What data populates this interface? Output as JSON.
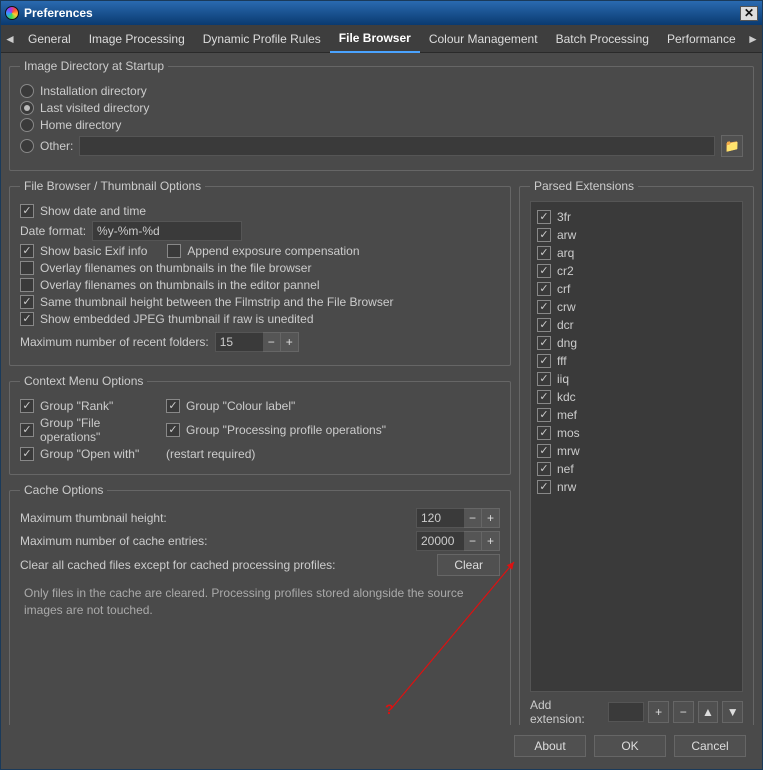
{
  "window": {
    "title": "Preferences",
    "close": "✕"
  },
  "tabs": {
    "scroll_left": "◄",
    "scroll_right": "►",
    "items": [
      "General",
      "Image Processing",
      "Dynamic Profile Rules",
      "File Browser",
      "Colour Management",
      "Batch Processing",
      "Performance"
    ],
    "active": 3
  },
  "startup": {
    "legend": "Image Directory at Startup",
    "options": [
      "Installation directory",
      "Last visited directory",
      "Home directory",
      "Other:"
    ],
    "selected": 1,
    "other_path": ""
  },
  "fb": {
    "legend": "File Browser / Thumbnail Options",
    "show_datetime": {
      "label": "Show date and time",
      "checked": true
    },
    "date_format_label": "Date format:",
    "date_format": "%y-%m-%d",
    "show_exif": {
      "label": "Show basic Exif info",
      "checked": true
    },
    "append_exp": {
      "label": "Append exposure compensation",
      "checked": false
    },
    "overlay_browser": {
      "label": "Overlay filenames on thumbnails in the file browser",
      "checked": false
    },
    "overlay_editor": {
      "label": "Overlay filenames on thumbnails in the editor pannel",
      "checked": false
    },
    "same_height": {
      "label": "Same thumbnail height between the Filmstrip and the File Browser",
      "checked": true
    },
    "embedded_jpeg": {
      "label": "Show embedded JPEG thumbnail if raw is unedited",
      "checked": true
    },
    "recent_label": "Maximum number of recent folders:",
    "recent_value": "15"
  },
  "ctx": {
    "legend": "Context Menu Options",
    "rank": {
      "label": "Group \"Rank\"",
      "checked": true
    },
    "colour": {
      "label": "Group \"Colour label\"",
      "checked": true
    },
    "fileops": {
      "label": "Group \"File operations\"",
      "checked": true
    },
    "profops": {
      "label": "Group \"Processing profile operations\"",
      "checked": true
    },
    "openwith": {
      "label": "Group \"Open with\"",
      "checked": true
    },
    "restart": "(restart required)"
  },
  "cache": {
    "legend": "Cache Options",
    "thumb_label": "Maximum thumbnail height:",
    "thumb_value": "120",
    "entries_label": "Maximum number of cache entries:",
    "entries_value": "20000",
    "clear_label": "Clear all cached files except for cached processing profiles:",
    "clear_btn": "Clear",
    "note": "Only files in the cache are cleared. Processing profiles stored alongside the source images are not touched."
  },
  "parsed": {
    "legend": "Parsed Extensions",
    "items": [
      "3fr",
      "arw",
      "arq",
      "cr2",
      "crf",
      "crw",
      "dcr",
      "dng",
      "fff",
      "iiq",
      "kdc",
      "mef",
      "mos",
      "mrw",
      "nef",
      "nrw"
    ],
    "add_label": "Add extension:",
    "add_value": ""
  },
  "buttons": {
    "about": "About",
    "ok": "OK",
    "cancel": "Cancel"
  },
  "annotation": {
    "mark": "?"
  },
  "icons": {
    "minus": "−",
    "plus": "+",
    "up": "▲",
    "down": "▼",
    "folder": "📁"
  }
}
